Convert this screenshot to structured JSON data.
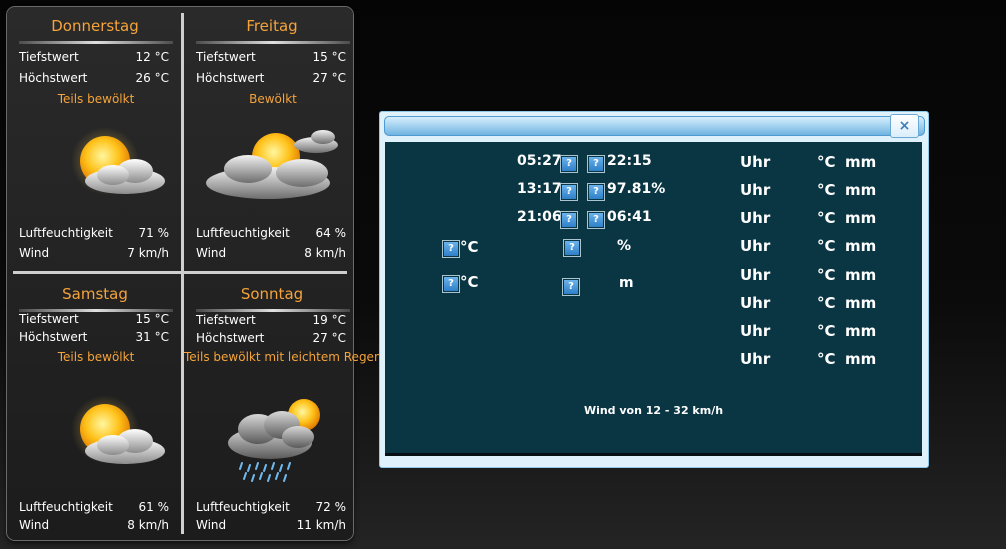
{
  "forecast": {
    "days": [
      {
        "name": "Donnerstag",
        "low_label": "Tiefstwert",
        "low": "12 °C",
        "high_label": "Höchstwert",
        "high": "26 °C",
        "condition": "Teils bewölkt",
        "humidity_label": "Luftfeuchtigkeit",
        "humidity": "71 %",
        "wind_label": "Wind",
        "wind": "7 km/h",
        "icon": "partly-cloudy-icon"
      },
      {
        "name": "Freitag",
        "low_label": "Tiefstwert",
        "low": "15 °C",
        "high_label": "Höchstwert",
        "high": "27 °C",
        "condition": "Bewölkt",
        "humidity_label": "Luftfeuchtigkeit",
        "humidity": "64 %",
        "wind_label": "Wind",
        "wind": "8 km/h",
        "icon": "cloudy-icon"
      },
      {
        "name": "Samstag",
        "low_label": "Tiefstwert",
        "low": "15 °C",
        "high_label": "Höchstwert",
        "high": "31 °C",
        "condition": "Teils bewölkt",
        "humidity_label": "Luftfeuchtigkeit",
        "humidity": "61 %",
        "wind_label": "Wind",
        "wind": "8 km/h",
        "icon": "partly-cloudy-icon"
      },
      {
        "name": "Sonntag",
        "low_label": "Tiefstwert",
        "low": "19 °C",
        "high_label": "Höchstwert",
        "high": "27 °C",
        "condition": "Teils bewölkt mit leichtem Regen",
        "humidity_label": "Luftfeuchtigkeit",
        "humidity": "72 %",
        "wind_label": "Wind",
        "wind": "11 km/h",
        "icon": "light-rain-icon"
      }
    ]
  },
  "dialog": {
    "close_label": "×",
    "placeholder_icon": "?",
    "times": [
      {
        "left": "05:27",
        "right": "22:15"
      },
      {
        "left": "13:17",
        "right": "97.81%"
      },
      {
        "left": "21:06",
        "right": "06:41"
      }
    ],
    "temp_unit": "°C",
    "percent_unit": "%",
    "temp_unit_2": "°C",
    "meter_unit": "m",
    "columns": {
      "uhr": [
        "Uhr",
        "Uhr",
        "Uhr",
        "Uhr",
        "Uhr",
        "Uhr",
        "Uhr",
        "Uhr"
      ],
      "celsius": [
        "°C",
        "°C",
        "°C",
        "°C",
        "°C",
        "°C",
        "°C",
        "°C"
      ],
      "mm": [
        "mm",
        "mm",
        "mm",
        "mm",
        "mm",
        "mm",
        "mm",
        "mm"
      ]
    },
    "wind_text": "Wind von 12 - 32 km/h"
  },
  "colors": {
    "accent_orange": "#f5a33a",
    "dialog_content_bg": "#0a3644",
    "titlebar_blue": "#6fb3e0"
  }
}
